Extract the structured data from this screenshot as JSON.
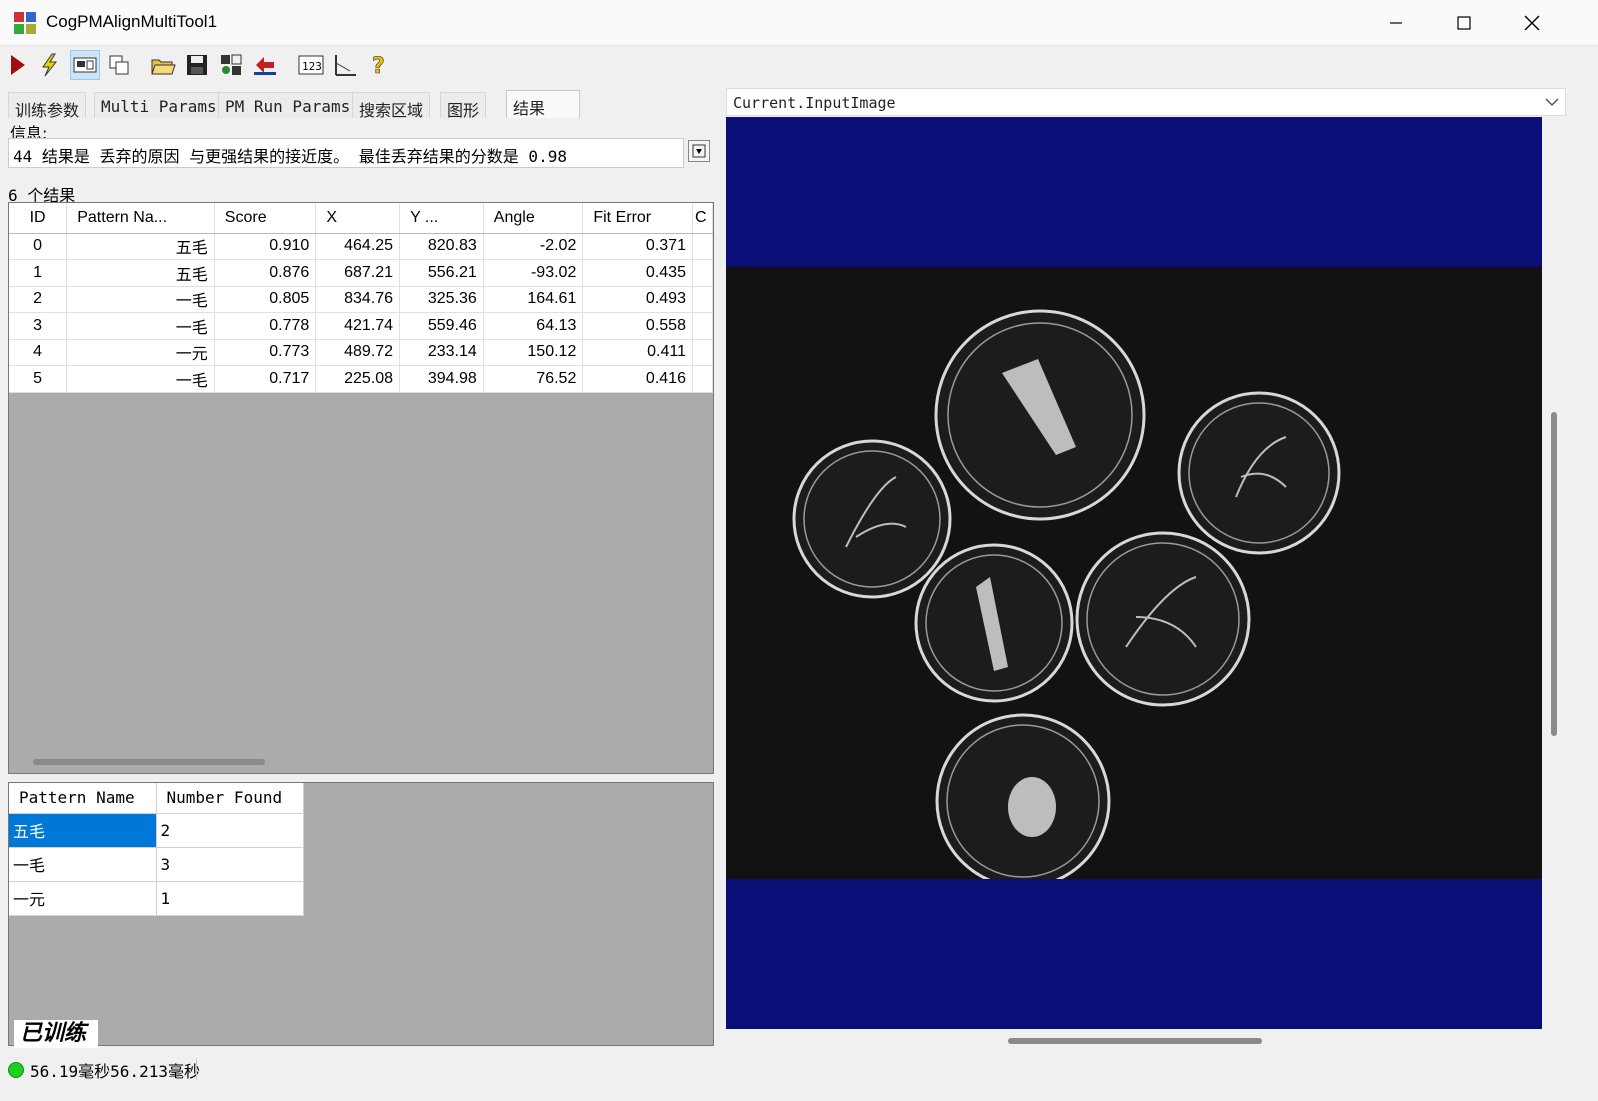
{
  "window": {
    "title": "CogPMAlignMultiTool1"
  },
  "tabs": [
    "训练参数",
    "Multi Params",
    "PM Run Params",
    "搜索区域",
    "图形",
    "结果"
  ],
  "info": {
    "label": "信息:",
    "message": "44 结果是 丢弃的原因 与更强结果的接近度。  最佳丢弃结果的分数是 0.98"
  },
  "results": {
    "count_label": "6 个结果",
    "columns": [
      "ID",
      "Pattern Na...",
      "Score",
      "X",
      "Y ...",
      "Angle",
      "Fit Error",
      "C"
    ],
    "rows": [
      [
        "0",
        "五毛",
        "0.910",
        "464.25",
        "820.83",
        "-2.02",
        "0.371"
      ],
      [
        "1",
        "五毛",
        "0.876",
        "687.21",
        "556.21",
        "-93.02",
        "0.435"
      ],
      [
        "2",
        "一毛",
        "0.805",
        "834.76",
        "325.36",
        "164.61",
        "0.493"
      ],
      [
        "3",
        "一毛",
        "0.778",
        "421.74",
        "559.46",
        "64.13",
        "0.558"
      ],
      [
        "4",
        "一元",
        "0.773",
        "489.72",
        "233.14",
        "150.12",
        "0.411"
      ],
      [
        "5",
        "一毛",
        "0.717",
        "225.08",
        "394.98",
        "76.52",
        "0.416"
      ]
    ]
  },
  "summary": {
    "columns": [
      "Pattern Name",
      "Number Found"
    ],
    "rows": [
      [
        "五毛",
        "2"
      ],
      [
        "一毛",
        "3"
      ],
      [
        "一元",
        "1"
      ]
    ]
  },
  "trained_label": "已训练",
  "status": {
    "text": "56.19毫秒56.213毫秒",
    "color": "#1ed01e"
  },
  "display": {
    "selected_image": "Current.InputImage"
  },
  "colors": {
    "display_background": "#0a0f78",
    "selection": "#0078d7"
  },
  "icons": [
    "run-icon",
    "electric-icon",
    "display-icon",
    "copy-icon",
    "open-folder-icon",
    "save-icon",
    "settings-icon",
    "reset-icon",
    "counter-icon",
    "ruler-icon",
    "help-icon"
  ]
}
